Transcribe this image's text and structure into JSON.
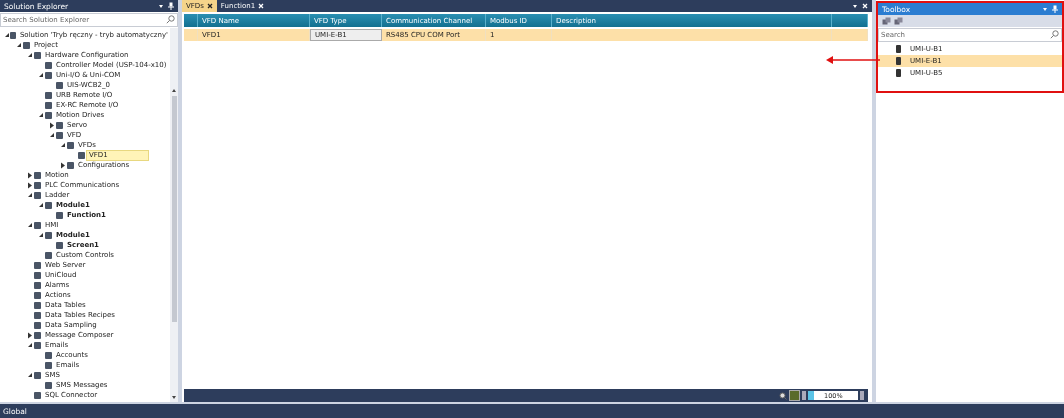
{
  "solution_explorer": {
    "title": "Solution Explorer",
    "search": {
      "placeholder": "Search Solution Explorer"
    },
    "tree": [
      {
        "label": "Solution 'Tryb ręczny - tryb automatyczny'",
        "expanded": true,
        "bold": false,
        "selected": false,
        "children": [
          {
            "label": "Project",
            "expanded": true,
            "bold": false,
            "selected": false,
            "children": [
              {
                "label": "Hardware Configuration",
                "expanded": true,
                "bold": false,
                "selected": false,
                "children": [
                  {
                    "label": "Controller Model (USP-104-x10)",
                    "bold": false,
                    "selected": false
                  },
                  {
                    "label": "Uni-I/O & Uni-COM",
                    "expanded": true,
                    "bold": false,
                    "selected": false,
                    "children": [
                      {
                        "label": "UIS-WCB2_0",
                        "bold": false,
                        "selected": false
                      }
                    ]
                  },
                  {
                    "label": "URB Remote I/O",
                    "bold": false,
                    "selected": false
                  },
                  {
                    "label": "EX-RC Remote I/O",
                    "bold": false,
                    "selected": false
                  },
                  {
                    "label": "Motion Drives",
                    "expanded": true,
                    "bold": false,
                    "selected": false,
                    "children": [
                      {
                        "label": "Servo",
                        "expanded": false,
                        "bold": false,
                        "selected": false
                      },
                      {
                        "label": "VFD",
                        "expanded": true,
                        "bold": false,
                        "selected": false,
                        "children": [
                          {
                            "label": "VFDs",
                            "expanded": true,
                            "bold": false,
                            "selected": false,
                            "children": [
                              {
                                "label": "VFD1",
                                "bold": false,
                                "selected": true
                              }
                            ]
                          },
                          {
                            "label": "Configurations",
                            "expanded": false,
                            "bold": false,
                            "selected": false
                          }
                        ]
                      }
                    ]
                  }
                ]
              },
              {
                "label": "Motion",
                "expanded": false,
                "bold": false,
                "selected": false
              },
              {
                "label": "PLC Communications",
                "expanded": false,
                "bold": false,
                "selected": false
              },
              {
                "label": "Ladder",
                "expanded": true,
                "bold": false,
                "selected": false,
                "children": [
                  {
                    "label": "Module1",
                    "expanded": true,
                    "bold": true,
                    "selected": false,
                    "children": [
                      {
                        "label": "Function1",
                        "bold": true,
                        "selected": false
                      }
                    ]
                  }
                ]
              },
              {
                "label": "HMI",
                "expanded": true,
                "bold": false,
                "selected": false,
                "children": [
                  {
                    "label": "Module1",
                    "expanded": true,
                    "bold": true,
                    "selected": false,
                    "children": [
                      {
                        "label": "Screen1",
                        "bold": true,
                        "selected": false
                      }
                    ]
                  },
                  {
                    "label": "Custom Controls",
                    "bold": false,
                    "selected": false
                  }
                ]
              },
              {
                "label": "Web Server",
                "bold": false,
                "selected": false
              },
              {
                "label": "UniCloud",
                "bold": false,
                "selected": false
              },
              {
                "label": "Alarms",
                "bold": false,
                "selected": false
              },
              {
                "label": "Actions",
                "bold": false,
                "selected": false
              },
              {
                "label": "Data Tables",
                "bold": false,
                "selected": false
              },
              {
                "label": "Data Tables Recipes",
                "bold": false,
                "selected": false
              },
              {
                "label": "Data Sampling",
                "bold": false,
                "selected": false
              },
              {
                "label": "Message Composer",
                "expanded": false,
                "bold": false,
                "selected": false
              },
              {
                "label": "Emails",
                "expanded": true,
                "bold": false,
                "selected": false,
                "children": [
                  {
                    "label": "Accounts",
                    "bold": false,
                    "selected": false
                  },
                  {
                    "label": "Emails",
                    "bold": false,
                    "selected": false
                  }
                ]
              },
              {
                "label": "SMS",
                "expanded": true,
                "bold": false,
                "selected": false,
                "children": [
                  {
                    "label": "SMS Messages",
                    "bold": false,
                    "selected": false
                  }
                ]
              },
              {
                "label": "SQL Connector",
                "bold": false,
                "selected": false
              }
            ]
          }
        ]
      }
    ]
  },
  "document": {
    "tabs": [
      {
        "label": "VFDs",
        "selected": true
      },
      {
        "label": "Function1",
        "selected": false
      }
    ],
    "table": {
      "columns": [
        "VFD Name",
        "VFD Type",
        "Communication Channel",
        "Modbus ID",
        "Description"
      ],
      "rows": [
        {
          "cells": [
            "VFD1",
            "UMI-E-B1",
            "RS485 CPU COM Port",
            "1",
            ""
          ],
          "selected": true
        }
      ]
    },
    "zoom": "100%"
  },
  "toolbox": {
    "title": "Toolbox",
    "search": {
      "placeholder": "Search"
    },
    "items": [
      {
        "label": "UMI-U-B1",
        "selected": false
      },
      {
        "label": "UMI-E-B1",
        "selected": true
      },
      {
        "label": "UMI-U-B5",
        "selected": false
      }
    ]
  },
  "bottom_panel": {
    "title": "Global"
  }
}
